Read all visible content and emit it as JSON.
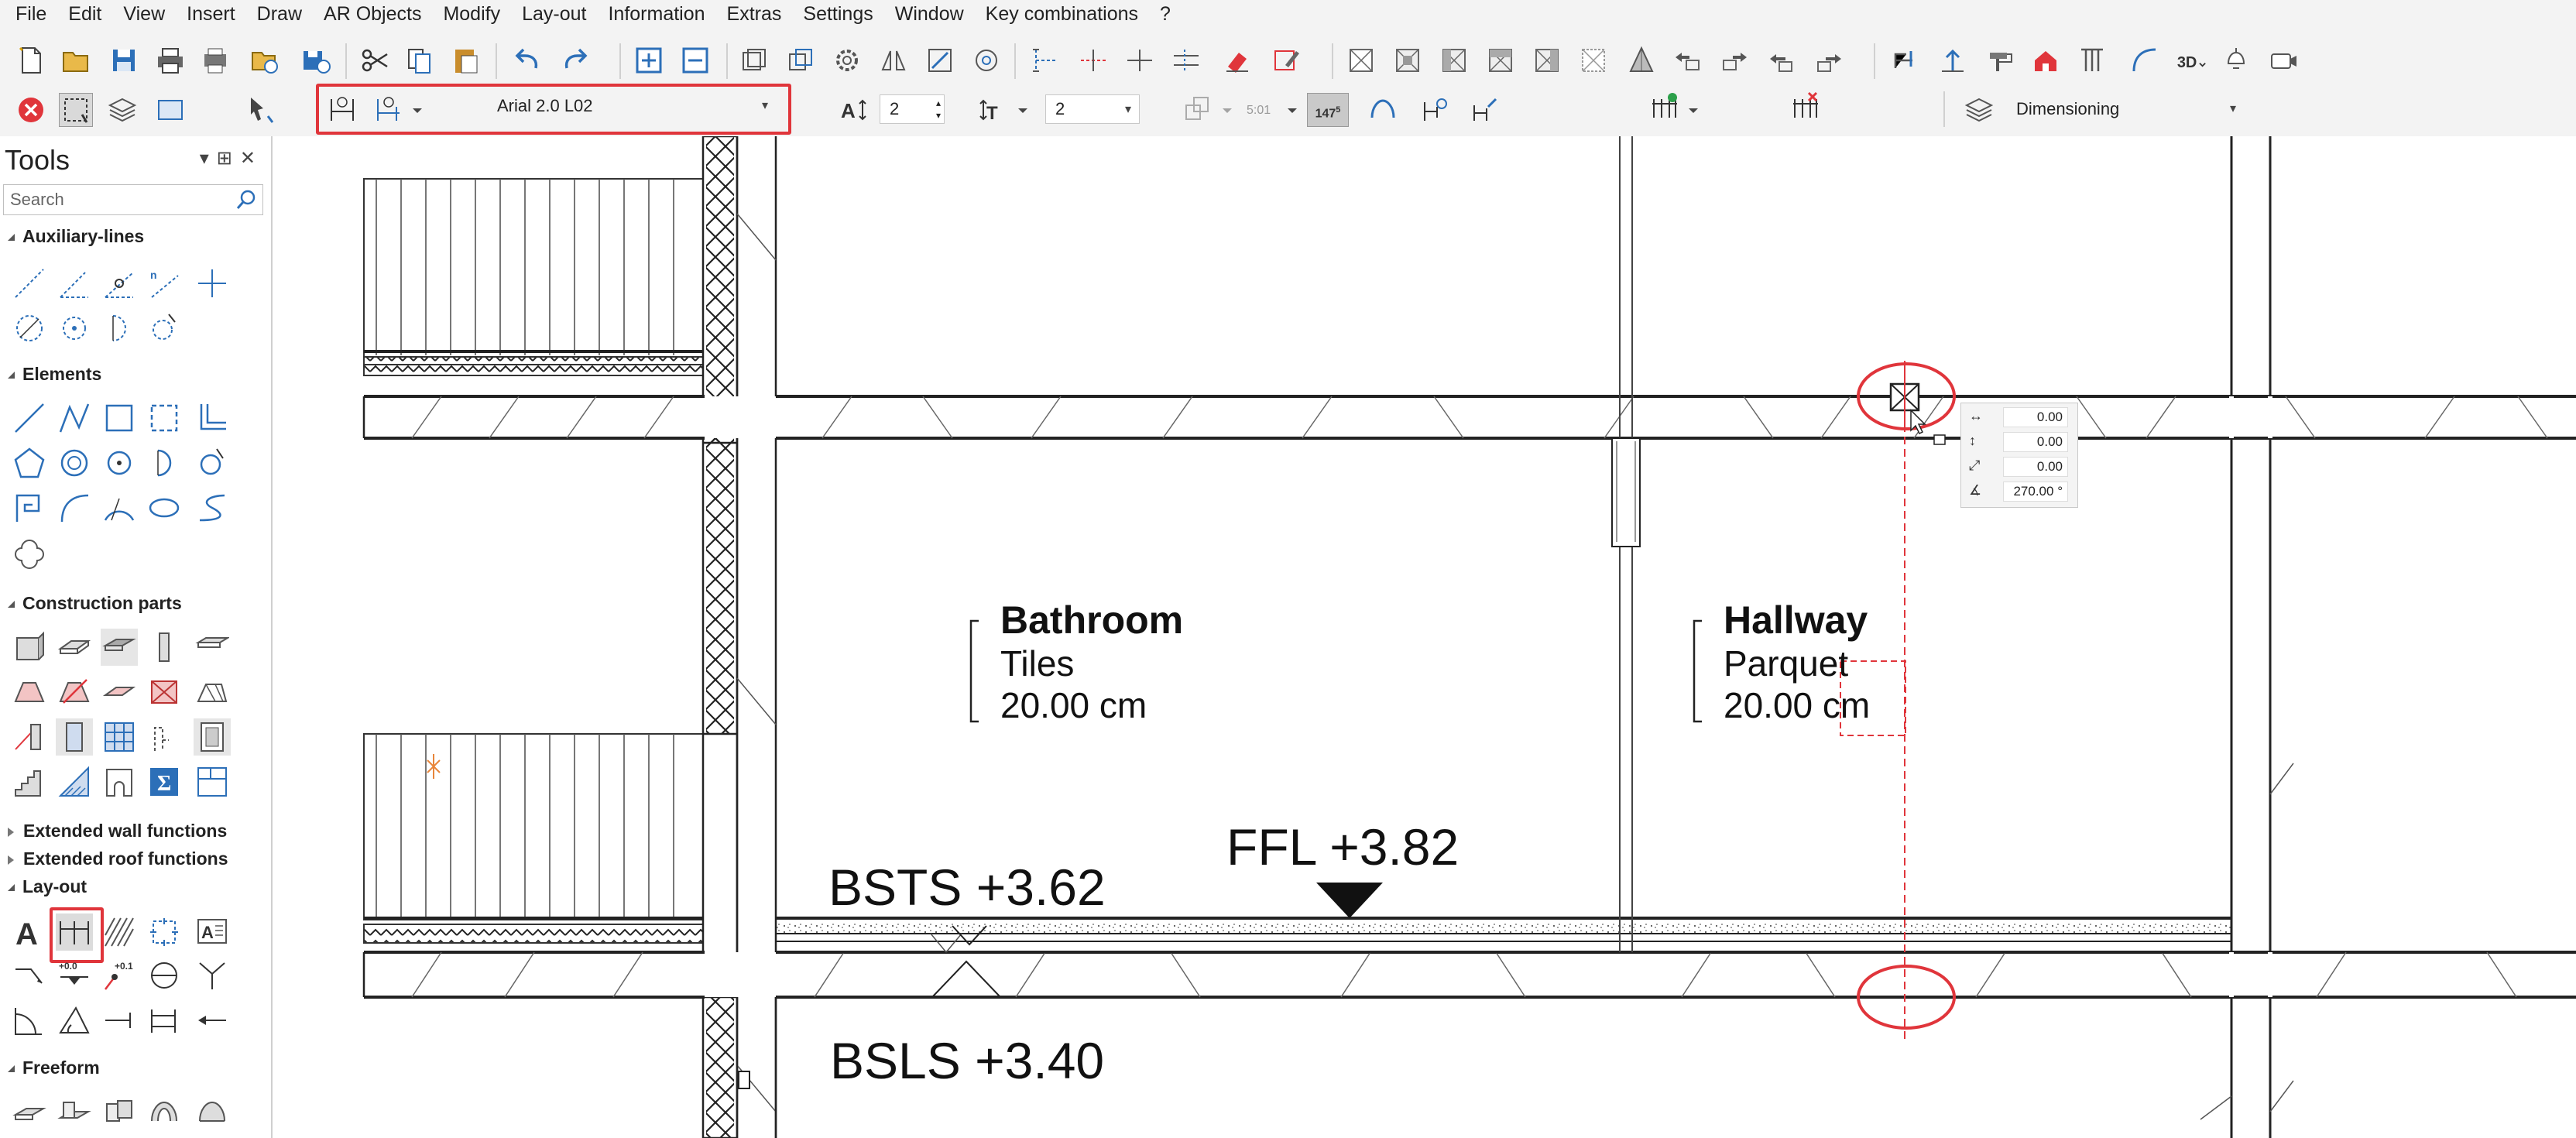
{
  "menu": [
    "File",
    "Edit",
    "View",
    "Insert",
    "Draw",
    "AR Objects",
    "Modify",
    "Lay-out",
    "Information",
    "Extras",
    "Settings",
    "Window",
    "Key combinations",
    "?"
  ],
  "toolbar": {
    "font_value": "Arial 2.0 L02",
    "text_height_value": "2",
    "line_spacing_value": "2",
    "scale_badge": "147",
    "scale_sup": "5",
    "ratio_label": "5:01",
    "layer_value": "Dimensioning",
    "highlight_color": "#e0353b"
  },
  "tools_panel": {
    "title": "Tools",
    "search_placeholder": "Search",
    "sections": {
      "auxiliary": "Auxiliary-lines",
      "elements": "Elements",
      "construction": "Construction parts",
      "ext_wall": "Extended wall functions",
      "ext_roof": "Extended roof functions",
      "layout": "Lay-out",
      "freeform": "Freeform"
    },
    "layout_level_label": "+0.0",
    "layout_level_label2": "+0.1"
  },
  "drawing": {
    "bathroom": {
      "name": "Bathroom",
      "material": "Tiles",
      "thickness": "20.00 cm"
    },
    "hallway": {
      "name": "Hallway",
      "material": "Parquet",
      "thickness": "20.00 cm"
    },
    "ffl": "FFL +3.82",
    "bsts": "BSTS +3.62",
    "bsls": "BSLS +3.40"
  },
  "coord_popup": {
    "dx": "0.00",
    "dy": "0.00",
    "length": "0.00",
    "angle": "270.00 °"
  }
}
